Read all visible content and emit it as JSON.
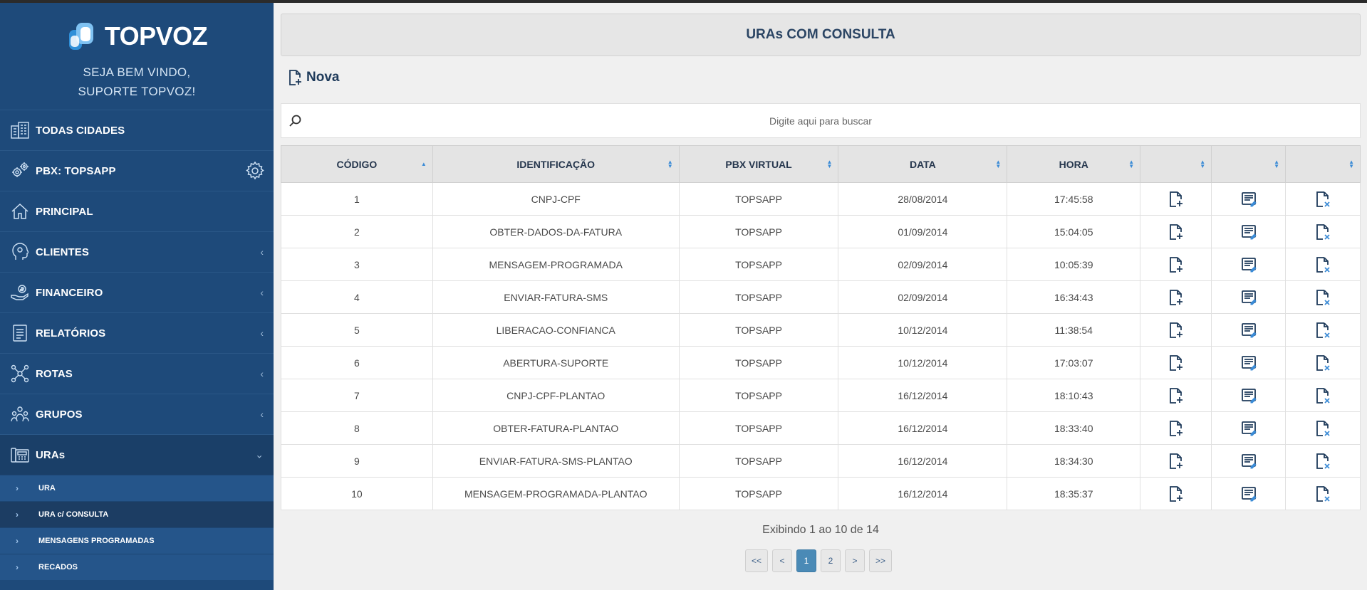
{
  "brand": {
    "logo_text": "TOPVOZ",
    "welcome_line1": "SEJA BEM VINDO,",
    "welcome_line2": "SUPORTE TOPVOZ!"
  },
  "sidebar": {
    "items": [
      {
        "label": "TODAS CIDADES",
        "icon": "city-buildings-icon",
        "chevron": false
      },
      {
        "label": "PBX: TOPSAPP",
        "icon": "gears-icon",
        "chevron": false
      },
      {
        "label": "PRINCIPAL",
        "icon": "home-icon",
        "chevron": false
      },
      {
        "label": "CLIENTES",
        "icon": "head-gear-icon",
        "chevron": true
      },
      {
        "label": "FINANCEIRO",
        "icon": "money-hand-icon",
        "chevron": true
      },
      {
        "label": "RELATÓRIOS",
        "icon": "report-icon",
        "chevron": true
      },
      {
        "label": "ROTAS",
        "icon": "network-nodes-icon",
        "chevron": true
      },
      {
        "label": "GRUPOS",
        "icon": "group-icon",
        "chevron": true
      },
      {
        "label": "URAs",
        "icon": "phone-system-icon",
        "chevron": true,
        "expanded": true
      }
    ],
    "submenu": [
      {
        "label": "URA"
      },
      {
        "label": "URA c/ CONSULTA",
        "current": true
      },
      {
        "label": "MENSAGENS PROGRAMADAS"
      },
      {
        "label": "RECADOS"
      }
    ]
  },
  "page": {
    "title": "URAs COM CONSULTA",
    "new_label": "Nova",
    "search_placeholder": "Digite aqui para buscar"
  },
  "table": {
    "headers": [
      "CÓDIGO",
      "IDENTIFICAÇÃO",
      "PBX VIRTUAL",
      "DATA",
      "HORA",
      "",
      "",
      ""
    ],
    "rows": [
      {
        "codigo": "1",
        "identificacao": "CNPJ-CPF",
        "pbx": "TOPSAPP",
        "data": "28/08/2014",
        "hora": "17:45:58"
      },
      {
        "codigo": "2",
        "identificacao": "OBTER-DADOS-DA-FATURA",
        "pbx": "TOPSAPP",
        "data": "01/09/2014",
        "hora": "15:04:05"
      },
      {
        "codigo": "3",
        "identificacao": "MENSAGEM-PROGRAMADA",
        "pbx": "TOPSAPP",
        "data": "02/09/2014",
        "hora": "10:05:39"
      },
      {
        "codigo": "4",
        "identificacao": "ENVIAR-FATURA-SMS",
        "pbx": "TOPSAPP",
        "data": "02/09/2014",
        "hora": "16:34:43"
      },
      {
        "codigo": "5",
        "identificacao": "LIBERACAO-CONFIANCA",
        "pbx": "TOPSAPP",
        "data": "10/12/2014",
        "hora": "11:38:54"
      },
      {
        "codigo": "6",
        "identificacao": "ABERTURA-SUPORTE",
        "pbx": "TOPSAPP",
        "data": "10/12/2014",
        "hora": "17:03:07"
      },
      {
        "codigo": "7",
        "identificacao": "CNPJ-CPF-PLANTAO",
        "pbx": "TOPSAPP",
        "data": "16/12/2014",
        "hora": "18:10:43"
      },
      {
        "codigo": "8",
        "identificacao": "OBTER-FATURA-PLANTAO",
        "pbx": "TOPSAPP",
        "data": "16/12/2014",
        "hora": "18:33:40"
      },
      {
        "codigo": "9",
        "identificacao": "ENVIAR-FATURA-SMS-PLANTAO",
        "pbx": "TOPSAPP",
        "data": "16/12/2014",
        "hora": "18:34:30"
      },
      {
        "codigo": "10",
        "identificacao": "MENSAGEM-PROGRAMADA-PLANTAO",
        "pbx": "TOPSAPP",
        "data": "16/12/2014",
        "hora": "18:35:37"
      }
    ],
    "row_actions": [
      "add-file-icon",
      "edit-list-icon",
      "delete-file-icon"
    ]
  },
  "pagination": {
    "info": "Exibindo 1 ao 10 de 14",
    "buttons": [
      "<<",
      "<",
      "1",
      "2",
      ">",
      ">>"
    ],
    "current": "1"
  },
  "colors": {
    "sidebar_bg": "#1e4a7a",
    "submenu_bg": "#25558a",
    "accent": "#3b8bd6",
    "pager_active": "#4a8ab6"
  }
}
